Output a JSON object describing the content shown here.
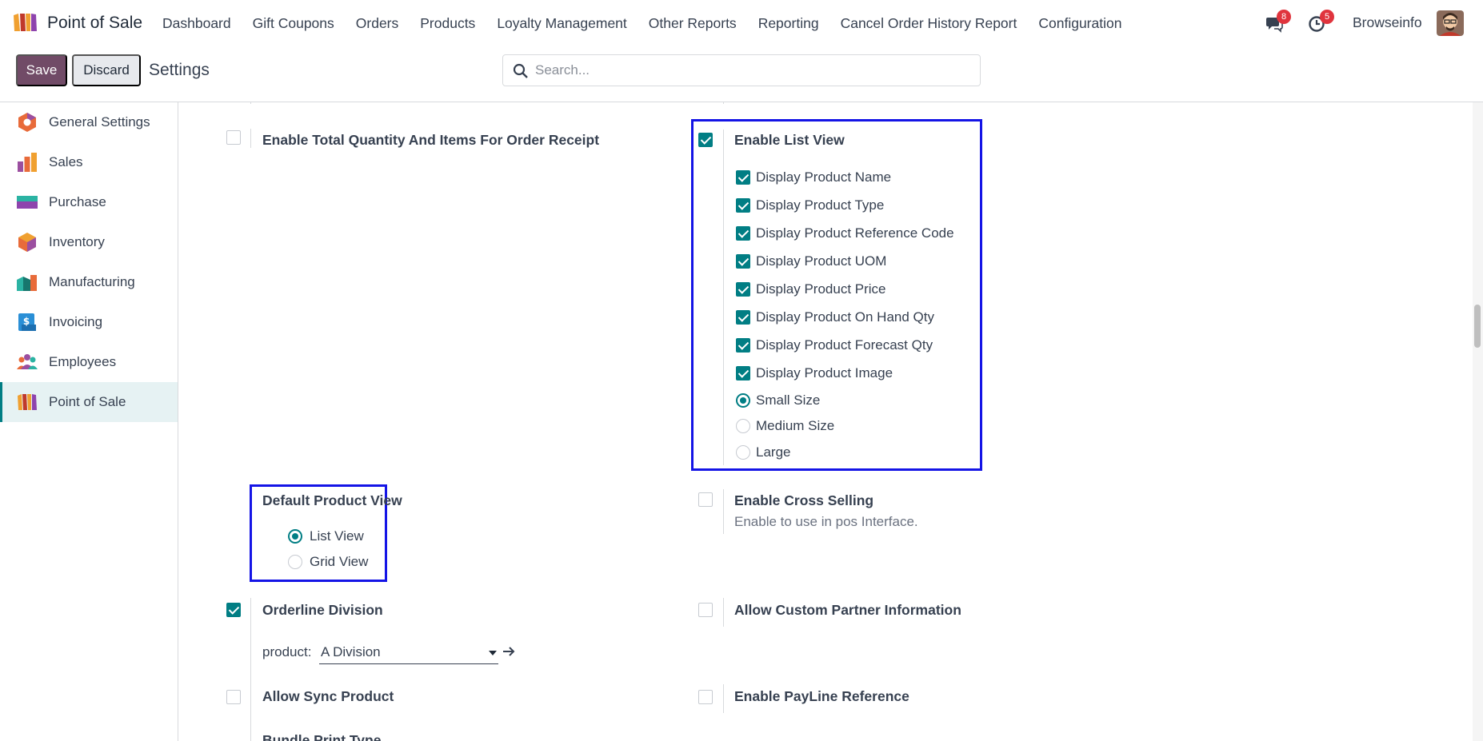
{
  "navbar": {
    "app_name": "Point of Sale",
    "menu": [
      "Dashboard",
      "Gift Coupons",
      "Orders",
      "Products",
      "Loyalty Management",
      "Other Reports",
      "Reporting",
      "Cancel Order History Report",
      "Configuration"
    ],
    "messages_badge": "8",
    "activities_badge": "5",
    "company": "Browseinfo"
  },
  "control_panel": {
    "save_label": "Save",
    "discard_label": "Discard",
    "breadcrumb": "Settings",
    "search_placeholder": "Search..."
  },
  "sidebar": {
    "items": [
      {
        "label": "General Settings",
        "icon": "general-settings-icon"
      },
      {
        "label": "Sales",
        "icon": "sales-icon"
      },
      {
        "label": "Purchase",
        "icon": "purchase-icon"
      },
      {
        "label": "Inventory",
        "icon": "inventory-icon"
      },
      {
        "label": "Manufacturing",
        "icon": "manufacturing-icon"
      },
      {
        "label": "Invoicing",
        "icon": "invoicing-icon"
      },
      {
        "label": "Employees",
        "icon": "employees-icon"
      },
      {
        "label": "Point of Sale",
        "icon": "point-of-sale-icon",
        "active": true
      }
    ]
  },
  "settings": {
    "total_qty": {
      "title": "Enable Total Quantity And Items For Order Receipt",
      "checked": false
    },
    "list_view": {
      "title": "Enable List View",
      "checked": true,
      "options": [
        {
          "label": "Display Product Name",
          "checked": true
        },
        {
          "label": "Display Product Type",
          "checked": true
        },
        {
          "label": "Display Product Reference Code",
          "checked": true
        },
        {
          "label": "Display Product UOM",
          "checked": true
        },
        {
          "label": "Display Product Price",
          "checked": true
        },
        {
          "label": "Display Product On Hand Qty",
          "checked": true
        },
        {
          "label": "Display Product Forecast Qty",
          "checked": true
        },
        {
          "label": "Display Product Image",
          "checked": true
        }
      ],
      "sizes": [
        {
          "label": "Small Size",
          "selected": true
        },
        {
          "label": "Medium Size",
          "selected": false
        },
        {
          "label": "Large",
          "selected": false
        }
      ]
    },
    "default_view": {
      "title": "Default Product View",
      "options": [
        {
          "label": "List View",
          "selected": true
        },
        {
          "label": "Grid View",
          "selected": false
        }
      ]
    },
    "cross_selling": {
      "title": "Enable Cross Selling",
      "desc": "Enable to use in pos Interface.",
      "checked": false
    },
    "orderline": {
      "title": "Orderline Division",
      "checked": true,
      "field_label": "product:",
      "field_value": "A Division"
    },
    "custom_partner": {
      "title": "Allow Custom Partner Information",
      "checked": false
    },
    "sync_product": {
      "title": "Allow Sync Product",
      "checked": false
    },
    "payline": {
      "title": "Enable PayLine Reference",
      "checked": false
    },
    "bundle": {
      "title": "Bundle Print Type"
    }
  },
  "colors": {
    "brand": "#714b67",
    "accent": "#017e84",
    "highlight": "#1414e6",
    "badge": "#e0343d"
  }
}
